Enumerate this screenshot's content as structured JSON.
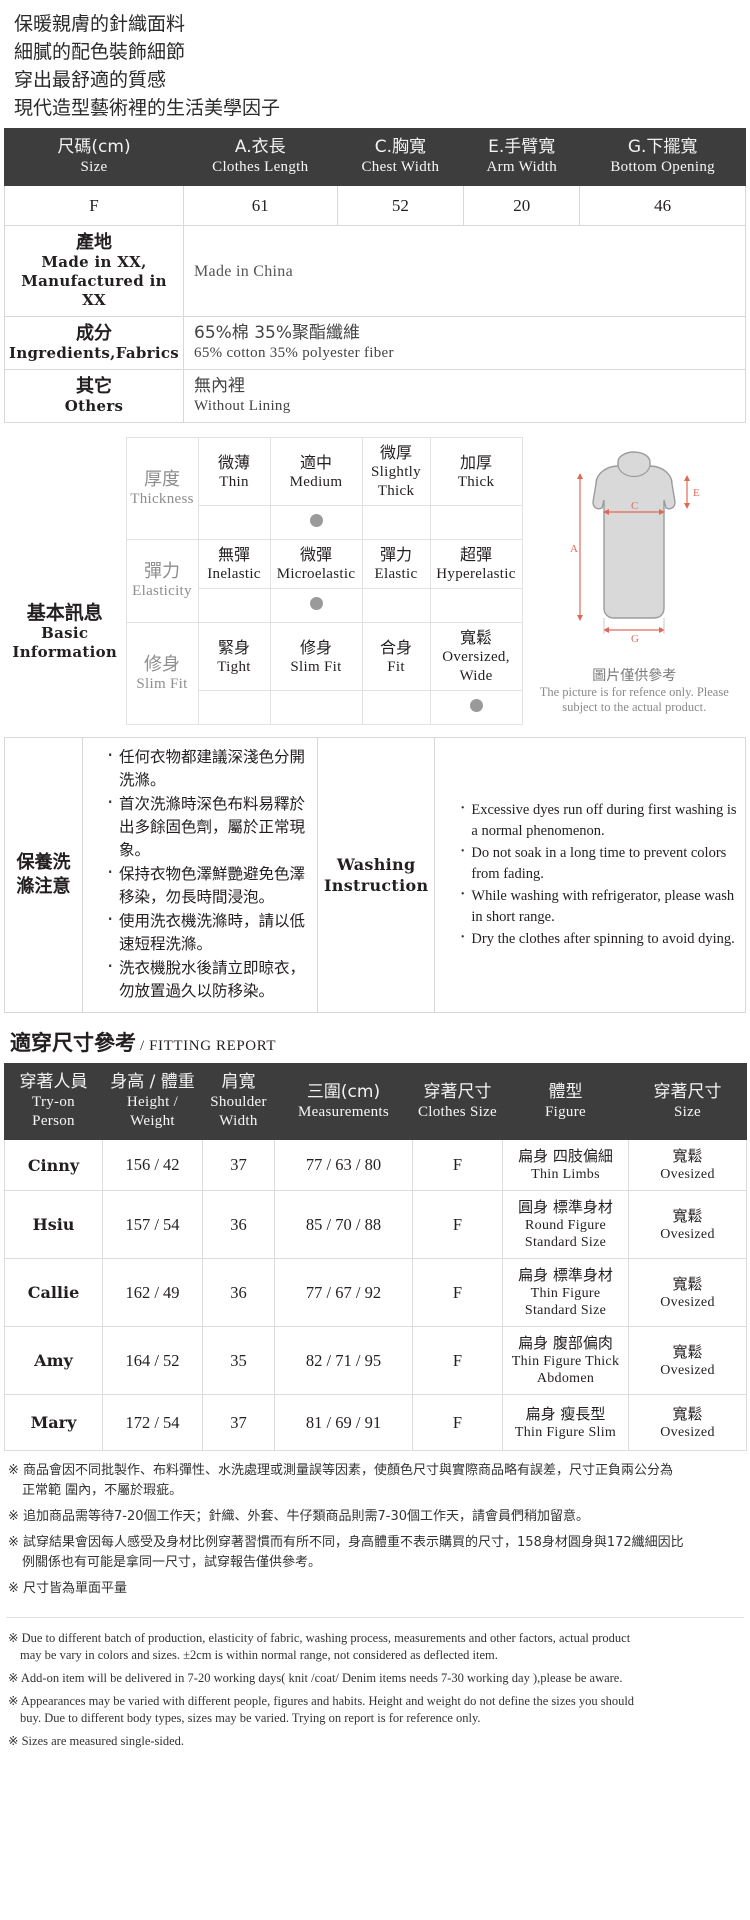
{
  "intro": {
    "lines": [
      "保暖親膚的針織面料",
      "細膩的配色裝飾細節",
      "穿出最舒適的質感",
      "現代造型藝術裡的生活美學因子"
    ]
  },
  "size_table": {
    "headers": [
      {
        "cn": "尺碼(cm)",
        "en": "Size"
      },
      {
        "cn": "A.衣長",
        "en": "Clothes Length"
      },
      {
        "cn": "C.胸寬",
        "en": "Chest Width"
      },
      {
        "cn": "E.手臂寬",
        "en": "Arm Width"
      },
      {
        "cn": "G.下擺寬",
        "en": "Bottom Opening"
      }
    ],
    "rows": [
      [
        "F",
        "61",
        "52",
        "20",
        "46"
      ]
    ],
    "info_rows": [
      {
        "label_cn": "產地",
        "label_en": "Made in XX, Manufactured in XX",
        "value_cn": "Made in China",
        "value_en": ""
      },
      {
        "label_cn": "成分",
        "label_en": "Ingredients,Fabrics",
        "value_cn": "65%棉 35%聚酯纖維",
        "value_en": "65% cotton 35% polyester fiber"
      },
      {
        "label_cn": "其它",
        "label_en": "Others",
        "value_cn": "無內裡",
        "value_en": "Without Lining"
      }
    ]
  },
  "basic_info": {
    "label_cn": "基本訊息",
    "label_en": "Basic Information",
    "attributes": [
      {
        "name_cn": "厚度",
        "name_en": "Thickness",
        "options": [
          {
            "cn": "微薄",
            "en": "Thin"
          },
          {
            "cn": "適中",
            "en": "Medium"
          },
          {
            "cn": "微厚",
            "en": "Slightly Thick"
          },
          {
            "cn": "加厚",
            "en": "Thick"
          }
        ],
        "selected": 1
      },
      {
        "name_cn": "彈力",
        "name_en": "Elasticity",
        "options": [
          {
            "cn": "無彈",
            "en": "Inelastic"
          },
          {
            "cn": "微彈",
            "en": "Microelastic"
          },
          {
            "cn": "彈力",
            "en": "Elastic"
          },
          {
            "cn": "超彈",
            "en": "Hyperelastic"
          }
        ],
        "selected": 1
      },
      {
        "name_cn": "修身",
        "name_en": "Slim Fit",
        "options": [
          {
            "cn": "緊身",
            "en": "Tight"
          },
          {
            "cn": "修身",
            "en": "Slim Fit"
          },
          {
            "cn": "合身",
            "en": "Fit"
          },
          {
            "cn": "寬鬆",
            "en": "Oversized, Wide"
          }
        ],
        "selected": 3
      }
    ],
    "illustration": {
      "markers": [
        "A",
        "C",
        "E",
        "G"
      ],
      "caption_cn": "圖片僅供參考",
      "caption_en": "The picture is for refence only. Please subject to the actual product."
    }
  },
  "washing": {
    "label_cn": "保養洗滌注意",
    "label_en": "Washing Instruction",
    "items_cn": [
      "任何衣物都建議深淺色分開洗滌。",
      "首次洗滌時深色布料易釋於出多餘固色劑，屬於正常現象。",
      "保持衣物色澤鮮艷避免色澤移染，勿長時間浸泡。",
      "使用洗衣機洗滌時，請以低速短程洗滌。",
      "洗衣機脫水後請立即晾衣，勿放置過久以防移染。"
    ],
    "items_en": [
      "Excessive dyes run off during first washing is a normal phenomenon.",
      "Do not soak in a long time to prevent colors from fading.",
      "While washing with refrigerator, please wash in short range.",
      "Dry the clothes after spinning to avoid dying."
    ]
  },
  "fitting_report": {
    "title_cn": "適穿尺寸參考",
    "title_en": "/ FITTING REPORT",
    "headers": [
      {
        "cn": "穿著人員",
        "en": "Try-on Person"
      },
      {
        "cn": "身高 / 體重",
        "en": "Height / Weight"
      },
      {
        "cn": "肩寬",
        "en": "Shoulder Width"
      },
      {
        "cn": "三圍(cm)",
        "en": "Measurements"
      },
      {
        "cn": "穿著尺寸",
        "en": "Clothes Size"
      },
      {
        "cn": "體型",
        "en": "Figure"
      },
      {
        "cn": "穿著尺寸",
        "en": "Size"
      }
    ],
    "rows": [
      {
        "person": "Cinny",
        "hw": "156 / 42",
        "shoulder": "37",
        "measurements": "77 / 63 / 80",
        "size": "F",
        "figure_cn": "扁身 四肢偏細",
        "figure_en": "Thin Limbs",
        "fit_cn": "寬鬆",
        "fit_en": "Ovesized"
      },
      {
        "person": "Hsiu",
        "hw": "157 / 54",
        "shoulder": "36",
        "measurements": "85 / 70 / 88",
        "size": "F",
        "figure_cn": "圓身 標準身材",
        "figure_en": "Round Figure Standard Size",
        "fit_cn": "寬鬆",
        "fit_en": "Ovesized"
      },
      {
        "person": "Callie",
        "hw": "162 / 49",
        "shoulder": "36",
        "measurements": "77 / 67 / 92",
        "size": "F",
        "figure_cn": "扁身 標準身材",
        "figure_en": "Thin Figure Standard Size",
        "fit_cn": "寬鬆",
        "fit_en": "Ovesized"
      },
      {
        "person": "Amy",
        "hw": "164 / 52",
        "shoulder": "35",
        "measurements": "82 / 71 / 95",
        "size": "F",
        "figure_cn": "扁身 腹部偏肉",
        "figure_en": "Thin Figure Thick Abdomen",
        "fit_cn": "寬鬆",
        "fit_en": "Ovesized"
      },
      {
        "person": "Mary",
        "hw": "172 / 54",
        "shoulder": "37",
        "measurements": "81 / 69 / 91",
        "size": "F",
        "figure_cn": "扁身 瘦長型",
        "figure_en": "Thin Figure Slim",
        "fit_cn": "寬鬆",
        "fit_en": "Ovesized"
      }
    ]
  },
  "notes_cn": [
    {
      "main": "※ 商品會因不同批製作、布料彈性、水洗處理或測量誤等因素，使顏色尺寸與實際商品略有誤差，尺寸正負兩公分為",
      "cont": "正常範 圍內，不屬於瑕疵。"
    },
    {
      "main": "※ 追加商品需等待7-20個工作天；針織、外套、牛仔類商品則需7-30個工作天，請會員們稍加留意。",
      "cont": ""
    },
    {
      "main": "※ 試穿結果會因每人感受及身材比例穿著習慣而有所不同，身高體重不表示購買的尺寸，158身材圓身與172纖細因比",
      "cont": "例關係也有可能是拿同一尺寸，試穿報告僅供參考。"
    },
    {
      "main": "※ 尺寸皆為單面平量",
      "cont": ""
    }
  ],
  "notes_en": [
    {
      "main": "※ Due to different batch of production, elasticity of fabric, washing process, measurements and other factors, actual product",
      "cont": "may be vary in colors and sizes. ±2cm is within normal range, not considered as deflected item."
    },
    {
      "main": "※ Add-on item will be delivered in 7-20 working days( knit /coat/ Denim items needs 7-30 working day ),please be aware.",
      "cont": ""
    },
    {
      "main": "※ Appearances may be varied with different people, figures and habits. Height and weight do not define the sizes you should",
      "cont": "buy. Due to different body types, sizes may be varied. Trying on report is for reference only."
    },
    {
      "main": "※ Sizes are measured single-sided.",
      "cont": ""
    }
  ]
}
